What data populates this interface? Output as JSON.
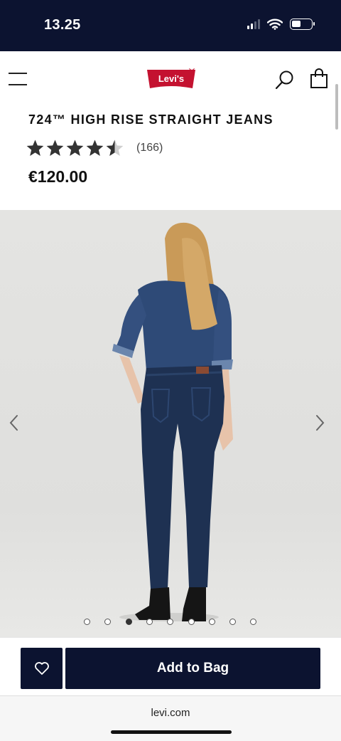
{
  "status_bar": {
    "time": "13.25"
  },
  "header": {
    "logo_text": "Levi's",
    "icons": {
      "menu": "menu-icon",
      "search": "search-icon",
      "bag": "shopping-bag-icon"
    }
  },
  "product": {
    "title": "724™ HIGH RISE STRAIGHT JEANS",
    "rating": 4.5,
    "rating_max": 5,
    "review_count": "(166)",
    "price": "€120.00"
  },
  "gallery": {
    "image_count": 9,
    "active_index": 2,
    "icons": {
      "prev": "chevron-left-icon",
      "next": "chevron-right-icon"
    }
  },
  "actions": {
    "wishlist_icon": "heart-icon",
    "add_to_bag_label": "Add to Bag"
  },
  "browser": {
    "url": "levi.com"
  },
  "colors": {
    "navy": "#0c1330",
    "logo_red": "#c41230",
    "background": "#ffffff"
  }
}
